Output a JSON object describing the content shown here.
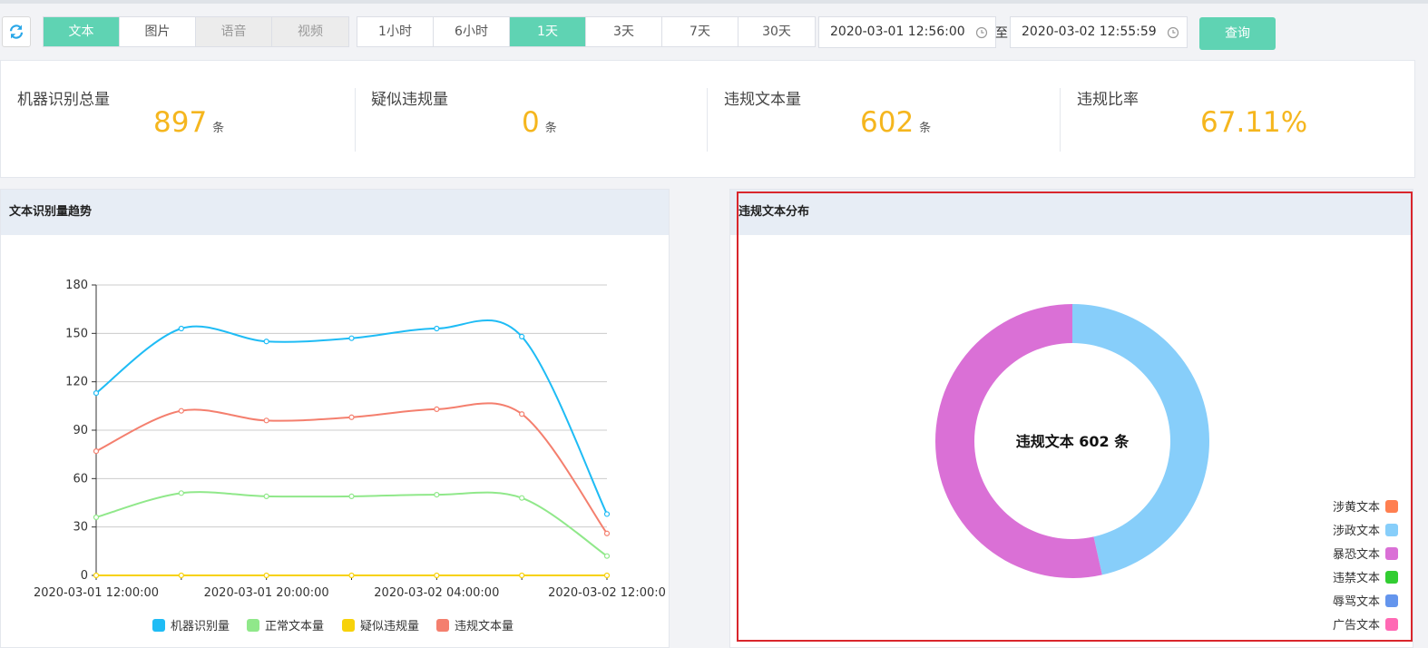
{
  "toolbar": {
    "media_tabs": [
      "文本",
      "图片",
      "语音",
      "视频"
    ],
    "range_tabs": [
      "1小时",
      "6小时",
      "1天",
      "3天",
      "7天",
      "30天"
    ],
    "start_time": "2020-03-01 12:56:00",
    "end_time": "2020-03-02 12:55:59",
    "to_label": "至",
    "query_label": "查询"
  },
  "stats": [
    {
      "label": "机器识别总量",
      "value": "897",
      "unit": "条"
    },
    {
      "label": "疑似违规量",
      "value": "0",
      "unit": "条"
    },
    {
      "label": "违规文本量",
      "value": "602",
      "unit": "条"
    },
    {
      "label": "违规比率",
      "value": "67.11%",
      "unit": ""
    }
  ],
  "trend_panel": {
    "title": "文本识别量趋势"
  },
  "dist_panel": {
    "title": "违规文本分布",
    "center_label": "违规文本 602 条"
  },
  "colors": {
    "accent": "#5fd3b3",
    "stat_value": "#f5b61e",
    "highlight_border": "#d9262c"
  },
  "chart_data": [
    {
      "type": "line",
      "x": [
        "2020-03-01 12:00:00",
        "2020-03-01 16:00:00",
        "2020-03-01 20:00:00",
        "2020-03-02 00:00:00",
        "2020-03-02 04:00:00",
        "2020-03-02 08:00:00",
        "2020-03-02 12:00:00"
      ],
      "x_tick_labels": [
        "2020-03-01 12:00:00",
        "2020-03-01 20:00:00",
        "2020-03-02 04:00:00",
        "2020-03-02 12:00:0"
      ],
      "ylim": [
        0,
        180
      ],
      "yticks": [
        0,
        30,
        60,
        90,
        120,
        150,
        180
      ],
      "grid": true,
      "legend": "bottom",
      "series": [
        {
          "name": "机器识别量",
          "color": "#1fbcf5",
          "values": [
            113,
            153,
            145,
            147,
            153,
            148,
            38
          ]
        },
        {
          "name": "正常文本量",
          "color": "#90e88a",
          "values": [
            36,
            51,
            49,
            49,
            50,
            48,
            12
          ]
        },
        {
          "name": "疑似违规量",
          "color": "#f7d20a",
          "values": [
            0,
            0,
            0,
            0,
            0,
            0,
            0
          ]
        },
        {
          "name": "违规文本量",
          "color": "#f47f6e",
          "values": [
            77,
            102,
            96,
            98,
            103,
            100,
            26
          ]
        }
      ]
    },
    {
      "type": "pie",
      "donut": true,
      "legend": "bottom-right",
      "slices": [
        {
          "name": "涉黄文本",
          "color": "#ff7f50",
          "value": 0
        },
        {
          "name": "涉政文本",
          "color": "#87cefa",
          "value": 280
        },
        {
          "name": "暴恐文本",
          "color": "#da70d6",
          "value": 322
        },
        {
          "name": "违禁文本",
          "color": "#32cd32",
          "value": 0
        },
        {
          "name": "辱骂文本",
          "color": "#6495ed",
          "value": 0
        },
        {
          "name": "广告文本",
          "color": "#ff69b4",
          "value": 0
        }
      ]
    }
  ]
}
